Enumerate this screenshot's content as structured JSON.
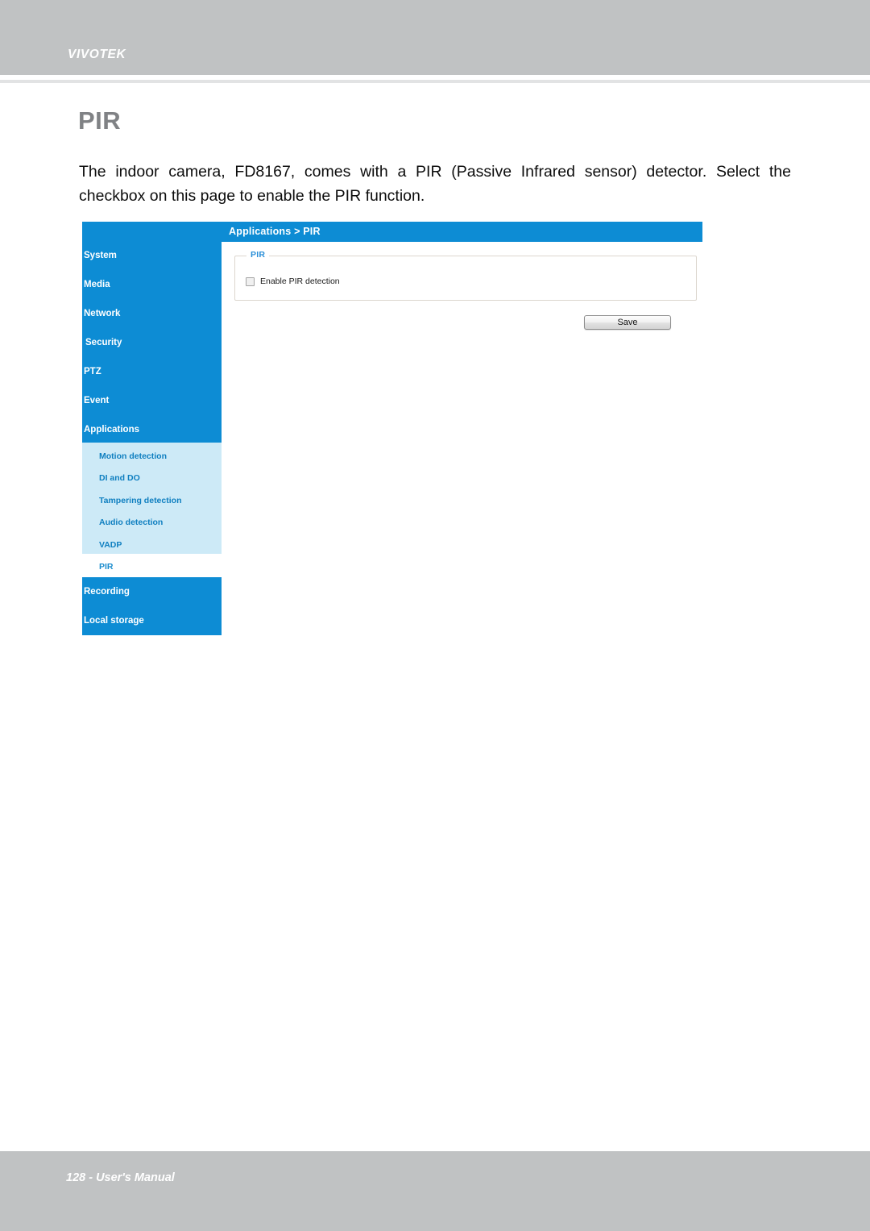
{
  "page": {
    "brand": "VIVOTEK",
    "title": "PIR",
    "paragraph": "The indoor camera, FD8167, comes with a PIR (Passive Infrared sensor) detector. Select the checkbox on this page to enable the PIR function.",
    "footer": "128 - User's Manual"
  },
  "screenshot": {
    "breadcrumb": "Applications  >  PIR",
    "sidebar": {
      "top_items": [
        {
          "label": "System"
        },
        {
          "label": "Media"
        },
        {
          "label": "Network"
        },
        {
          "label": "Security"
        },
        {
          "label": "PTZ"
        },
        {
          "label": "Event"
        },
        {
          "label": "Applications"
        }
      ],
      "sub_items": [
        {
          "label": "Motion detection"
        },
        {
          "label": "DI and DO"
        },
        {
          "label": "Tampering detection"
        },
        {
          "label": "Audio detection"
        },
        {
          "label": "VADP"
        }
      ],
      "selected_item": {
        "label": "PIR"
      },
      "bottom_items": [
        {
          "label": "Recording"
        },
        {
          "label": "Local storage"
        }
      ]
    },
    "panel": {
      "legend": "PIR",
      "checkbox_label": "Enable PIR detection",
      "checkbox_checked": false,
      "save_label": "Save"
    },
    "colors": {
      "nav_blue": "#0d8cd4",
      "submenu_blue": "#cdeaf7",
      "legend_blue": "#2a8fd8",
      "band_gray": "#c0c2c3",
      "title_gray": "#808285"
    }
  }
}
